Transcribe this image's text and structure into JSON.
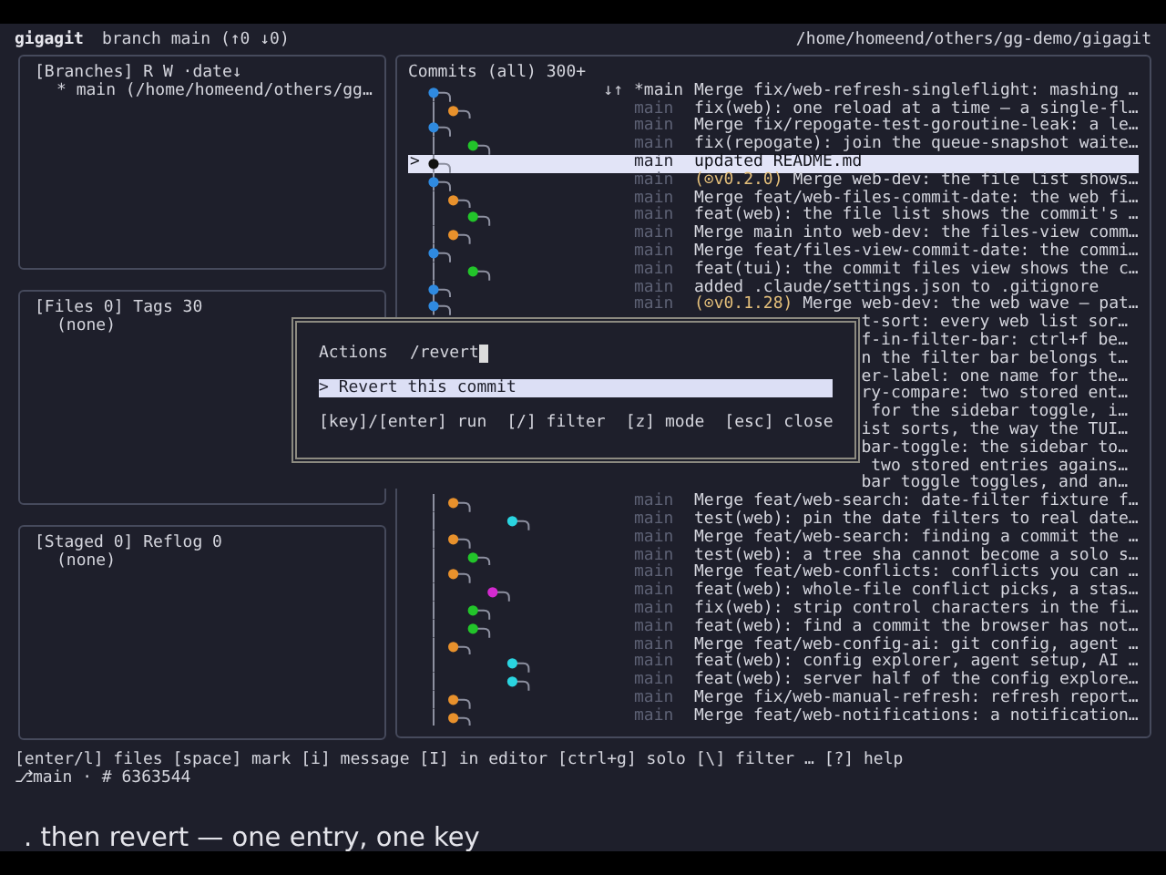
{
  "header": {
    "app": "gigagit",
    "branch": "branch main (↑0 ↓0)",
    "path": "/home/homeend/others/gg-demo/gigagit"
  },
  "panels": [
    {
      "title": "[Branches] R W ·date↓",
      "items": [
        "* main (/home/homeend/others/gg…"
      ]
    },
    {
      "title": "[Files 0] Tags 30",
      "items": [
        "(none)"
      ]
    },
    {
      "title": "[Staged 0] Reflog 0",
      "items": [
        "(none)"
      ]
    }
  ],
  "commits": {
    "title": "Commits (all) 300+",
    "rows": [
      {
        "kind": "commit",
        "color": "#2f8ae0",
        "marker": "↓↑",
        "ref": "*main",
        "current": true,
        "selected": false,
        "message": "Merge fix/web-refresh-singleflight: mashing …"
      },
      {
        "kind": "commit",
        "color": "#e8912c",
        "ref": "main",
        "current": false,
        "selected": false,
        "message": "fix(web): one reload at a time — a single-fl…"
      },
      {
        "kind": "commit",
        "color": "#2f8ae0",
        "ref": "main",
        "current": false,
        "selected": false,
        "message": "Merge fix/repogate-test-goroutine-leak: a le…"
      },
      {
        "kind": "commit",
        "color": "#22c42a",
        "ref": "main",
        "current": false,
        "selected": false,
        "message": "fix(repogate): join the queue-snapshot waite…"
      },
      {
        "kind": "commit",
        "color": "#111111",
        "pointer": ">",
        "ref": "main",
        "current": false,
        "selected": true,
        "message": "updated README.md"
      },
      {
        "kind": "commit",
        "color": "#2f8ae0",
        "ref": "main",
        "current": false,
        "selected": false,
        "tag": "(⊙v0.2.0)",
        "message": "Merge web-dev: the file list shows…"
      },
      {
        "kind": "commit",
        "color": "#e8912c",
        "ref": "main",
        "current": false,
        "selected": false,
        "message": "Merge feat/web-files-commit-date: the web fi…"
      },
      {
        "kind": "commit",
        "color": "#22c42a",
        "ref": "main",
        "current": false,
        "selected": false,
        "message": "feat(web): the file list shows the commit's …"
      },
      {
        "kind": "commit",
        "color": "#e8912c",
        "ref": "main",
        "current": false,
        "selected": false,
        "message": "Merge main into web-dev: the files-view comm…"
      },
      {
        "kind": "commit",
        "color": "#2f8ae0",
        "ref": "main",
        "current": false,
        "selected": false,
        "message": "Merge feat/files-view-commit-date: the commi…"
      },
      {
        "kind": "commit",
        "color": "#22c42a",
        "ref": "main",
        "current": false,
        "selected": false,
        "message": "feat(tui): the commit files view shows the c…"
      },
      {
        "kind": "commit",
        "color": "#2f8ae0",
        "ref": "main",
        "current": false,
        "selected": false,
        "message": "added .claude/settings.json to .gitignore"
      },
      {
        "kind": "commit",
        "color": "#2f8ae0",
        "ref": "main",
        "current": false,
        "selected": false,
        "tag": "(⊙v0.1.28)",
        "message": "Merge web-dev: the web wave — pat…"
      },
      {
        "kind": "covered",
        "message": "t-sort: every web list sor…"
      },
      {
        "kind": "covered",
        "message": "f-in-filter-bar: ctrl+f be…"
      },
      {
        "kind": "covered",
        "message": "n the filter bar belongs t…"
      },
      {
        "kind": "covered",
        "message": "er-label: one name for the…"
      },
      {
        "kind": "covered",
        "message": "ry-compare: two stored ent…"
      },
      {
        "kind": "covered",
        "message": "for the sidebar toggle, i…"
      },
      {
        "kind": "covered",
        "message": "ist sorts, the way the TUI…"
      },
      {
        "kind": "covered",
        "message": "bar-toggle: the sidebar to…"
      },
      {
        "kind": "covered",
        "message": "two stored entries agains…"
      },
      {
        "kind": "covered",
        "message": "bar toggle toggles, and an…"
      },
      {
        "kind": "commit",
        "color": "#e8912c",
        "ref": "main",
        "current": false,
        "selected": false,
        "message": "Merge feat/web-search: date-filter fixture f…"
      },
      {
        "kind": "commit",
        "color": "#2ad4e0",
        "ref": "main",
        "current": false,
        "selected": false,
        "message": "test(web): pin the date filters to real date…"
      },
      {
        "kind": "commit",
        "color": "#e8912c",
        "ref": "main",
        "current": false,
        "selected": false,
        "message": "Merge feat/web-search: finding a commit the …"
      },
      {
        "kind": "commit",
        "color": "#22c42a",
        "ref": "main",
        "current": false,
        "selected": false,
        "message": "test(web): a tree sha cannot become a solo s…"
      },
      {
        "kind": "commit",
        "color": "#e8912c",
        "ref": "main",
        "current": false,
        "selected": false,
        "message": "Merge feat/web-conflicts: conflicts you can …"
      },
      {
        "kind": "commit",
        "color": "#d42ad0",
        "ref": "main",
        "current": false,
        "selected": false,
        "message": "feat(web): whole-file conflict picks, a stas…"
      },
      {
        "kind": "commit",
        "color": "#22c42a",
        "ref": "main",
        "current": false,
        "selected": false,
        "message": "fix(web): strip control characters in the fi…"
      },
      {
        "kind": "commit",
        "color": "#22c42a",
        "ref": "main",
        "current": false,
        "selected": false,
        "message": "feat(web): find a commit the browser has not…"
      },
      {
        "kind": "commit",
        "color": "#e8912c",
        "ref": "main",
        "current": false,
        "selected": false,
        "message": "Merge feat/web-config-ai: git config, agent …"
      },
      {
        "kind": "commit",
        "color": "#2ad4e0",
        "ref": "main",
        "current": false,
        "selected": false,
        "message": "feat(web): config explorer, agent setup, AI …"
      },
      {
        "kind": "commit",
        "color": "#2ad4e0",
        "ref": "main",
        "current": false,
        "selected": false,
        "message": "feat(web): server half of the config explore…"
      },
      {
        "kind": "commit",
        "color": "#e8912c",
        "ref": "main",
        "current": false,
        "selected": false,
        "message": "Merge fix/web-manual-refresh: refresh report…"
      },
      {
        "kind": "commit",
        "color": "#e8912c",
        "ref": "main",
        "current": false,
        "selected": false,
        "message": "Merge feat/web-notifications: a notification…"
      }
    ]
  },
  "dialog": {
    "title": "Actions",
    "query": "/revert",
    "items": [
      {
        "label": "> Revert this commit",
        "selected": true
      }
    ],
    "hints": [
      "[key]/[enter] run",
      "[/] filter",
      "[z] mode",
      "[esc] close"
    ]
  },
  "footer": {
    "keys": "[enter/l] files [space] mark [i] message [I] in editor [ctrl+g] solo [\\] filter … [?] help",
    "status": "⎇main · # 6363544"
  },
  "caption": ". then revert — one entry, one key"
}
